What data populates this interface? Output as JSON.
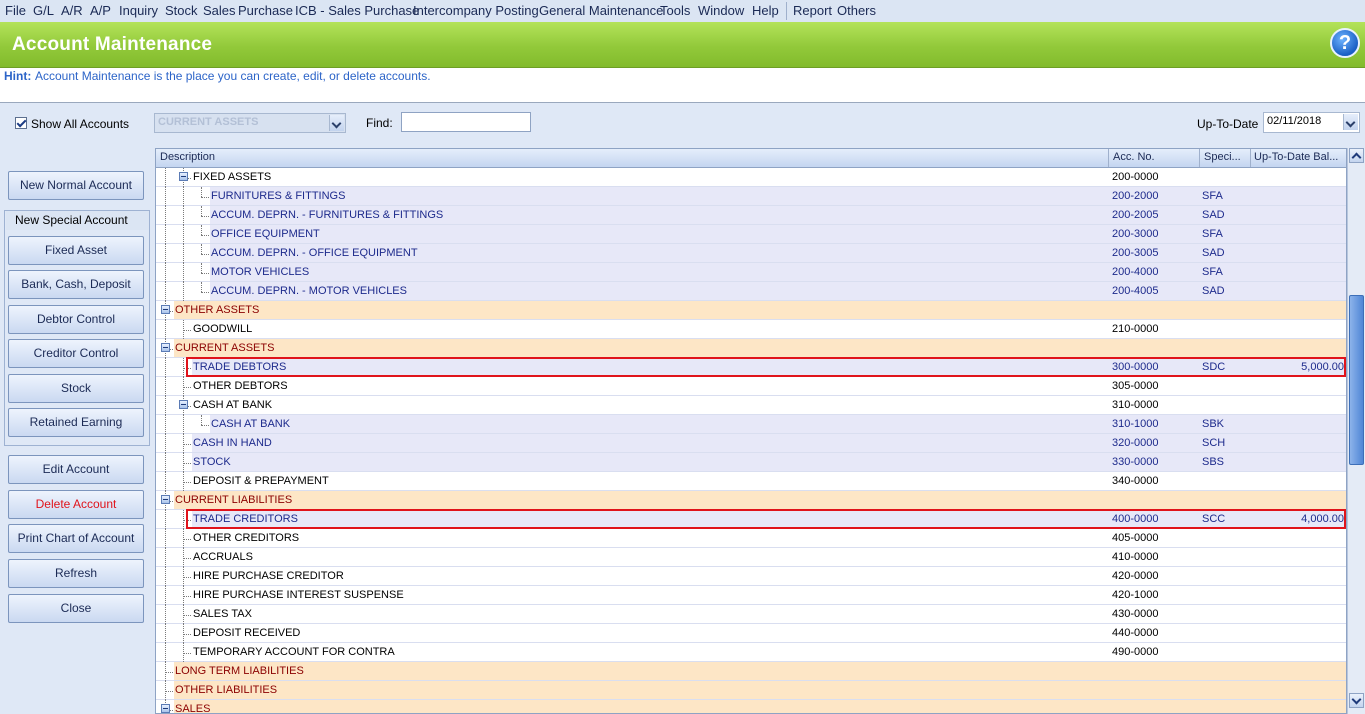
{
  "menu": [
    "File",
    "G/L",
    "A/R",
    "A/P",
    "Inquiry",
    "Stock",
    "Sales",
    "Purchase",
    "ICB - Sales Purchase",
    "Intercompany Posting",
    "General Maintenance",
    "Tools",
    "Window",
    "Help",
    "Report",
    "Others"
  ],
  "title": "Account Maintenance",
  "help_icon": "?",
  "hint": {
    "label": "Hint:",
    "text": "Account Maintenance is the place you can create, edit, or delete accounts."
  },
  "filter": {
    "show_all_label": "Show All Accounts",
    "show_all_checked": true,
    "category_value": "CURRENT ASSETS",
    "find_label": "Find:",
    "find_value": "",
    "uptodate_label": "Up-To-Date",
    "uptodate_value": "02/11/2018"
  },
  "buttons": {
    "new_normal": "New Normal Account",
    "new_special_title": "New Special Account",
    "fixed_asset": "Fixed Asset",
    "bank": "Bank, Cash, Deposit",
    "debtor": "Debtor Control",
    "creditor": "Creditor Control",
    "stock": "Stock",
    "retained": "Retained Earning",
    "edit": "Edit Account",
    "delete": "Delete Account",
    "print": "Print Chart of Account",
    "refresh": "Refresh",
    "close": "Close"
  },
  "grid": {
    "columns": [
      "Description",
      "Acc. No.",
      "Speci...",
      "Up-To-Date Bal..."
    ],
    "rows": [
      {
        "desc": "FIXED ASSETS",
        "acc": "200-0000",
        "spec": "",
        "bal": "",
        "level": 1,
        "type": "group",
        "expand": true
      },
      {
        "desc": "FURNITURES & FITTINGS",
        "acc": "200-2000",
        "spec": "SFA",
        "bal": "",
        "level": 2,
        "type": "special"
      },
      {
        "desc": "ACCUM. DEPRN. - FURNITURES & FITTINGS",
        "acc": "200-2005",
        "spec": "SAD",
        "bal": "",
        "level": 2,
        "type": "special"
      },
      {
        "desc": "OFFICE EQUIPMENT",
        "acc": "200-3000",
        "spec": "SFA",
        "bal": "",
        "level": 2,
        "type": "special"
      },
      {
        "desc": "ACCUM. DEPRN. - OFFICE EQUIPMENT",
        "acc": "200-3005",
        "spec": "SAD",
        "bal": "",
        "level": 2,
        "type": "special"
      },
      {
        "desc": "MOTOR VEHICLES",
        "acc": "200-4000",
        "spec": "SFA",
        "bal": "",
        "level": 2,
        "type": "special"
      },
      {
        "desc": "ACCUM. DEPRN. - MOTOR VEHICLES",
        "acc": "200-4005",
        "spec": "SAD",
        "bal": "",
        "level": 2,
        "type": "special"
      },
      {
        "desc": "OTHER ASSETS",
        "acc": "",
        "spec": "",
        "bal": "",
        "level": 0,
        "type": "category",
        "expand": true
      },
      {
        "desc": "GOODWILL",
        "acc": "210-0000",
        "spec": "",
        "bal": "",
        "level": 1,
        "type": "normal"
      },
      {
        "desc": "CURRENT ASSETS",
        "acc": "",
        "spec": "",
        "bal": "",
        "level": 0,
        "type": "category",
        "expand": true
      },
      {
        "desc": "TRADE DEBTORS",
        "acc": "300-0000",
        "spec": "SDC",
        "bal": "5,000.00",
        "level": 1,
        "type": "special",
        "highlight": true
      },
      {
        "desc": "OTHER DEBTORS",
        "acc": "305-0000",
        "spec": "",
        "bal": "",
        "level": 1,
        "type": "normal"
      },
      {
        "desc": "CASH AT BANK",
        "acc": "310-0000",
        "spec": "",
        "bal": "",
        "level": 1,
        "type": "group",
        "expand": true
      },
      {
        "desc": "CASH AT BANK",
        "acc": "310-1000",
        "spec": "SBK",
        "bal": "",
        "level": 2,
        "type": "special"
      },
      {
        "desc": "CASH IN HAND",
        "acc": "320-0000",
        "spec": "SCH",
        "bal": "",
        "level": 1,
        "type": "special"
      },
      {
        "desc": "STOCK",
        "acc": "330-0000",
        "spec": "SBS",
        "bal": "",
        "level": 1,
        "type": "special"
      },
      {
        "desc": "DEPOSIT & PREPAYMENT",
        "acc": "340-0000",
        "spec": "",
        "bal": "",
        "level": 1,
        "type": "normal"
      },
      {
        "desc": "CURRENT LIABILITIES",
        "acc": "",
        "spec": "",
        "bal": "",
        "level": 0,
        "type": "category",
        "expand": true
      },
      {
        "desc": "TRADE CREDITORS",
        "acc": "400-0000",
        "spec": "SCC",
        "bal": "4,000.00",
        "level": 1,
        "type": "special",
        "highlight": true
      },
      {
        "desc": "OTHER CREDITORS",
        "acc": "405-0000",
        "spec": "",
        "bal": "",
        "level": 1,
        "type": "normal"
      },
      {
        "desc": "ACCRUALS",
        "acc": "410-0000",
        "spec": "",
        "bal": "",
        "level": 1,
        "type": "normal"
      },
      {
        "desc": "HIRE PURCHASE CREDITOR",
        "acc": "420-0000",
        "spec": "",
        "bal": "",
        "level": 1,
        "type": "normal"
      },
      {
        "desc": "HIRE PURCHASE INTEREST SUSPENSE",
        "acc": "420-1000",
        "spec": "",
        "bal": "",
        "level": 1,
        "type": "normal"
      },
      {
        "desc": "SALES TAX",
        "acc": "430-0000",
        "spec": "",
        "bal": "",
        "level": 1,
        "type": "normal"
      },
      {
        "desc": "DEPOSIT RECEIVED",
        "acc": "440-0000",
        "spec": "",
        "bal": "",
        "level": 1,
        "type": "normal"
      },
      {
        "desc": "TEMPORARY ACCOUNT FOR CONTRA",
        "acc": "490-0000",
        "spec": "",
        "bal": "",
        "level": 1,
        "type": "normal"
      },
      {
        "desc": "LONG TERM LIABILITIES",
        "acc": "",
        "spec": "",
        "bal": "",
        "level": 0,
        "type": "category",
        "expand": false
      },
      {
        "desc": "OTHER LIABILITIES",
        "acc": "",
        "spec": "",
        "bal": "",
        "level": 0,
        "type": "category",
        "expand": false
      },
      {
        "desc": "SALES",
        "acc": "",
        "spec": "",
        "bal": "",
        "level": 0,
        "type": "category",
        "expand": true
      }
    ]
  },
  "colors": {
    "accent_green": "#92c93a",
    "category_bg": "#fde6c6",
    "special_bg": "#e7e8f8",
    "highlight_border": "#e0131b",
    "special_text": "#1d2a8c",
    "category_text": "#8b0000"
  }
}
